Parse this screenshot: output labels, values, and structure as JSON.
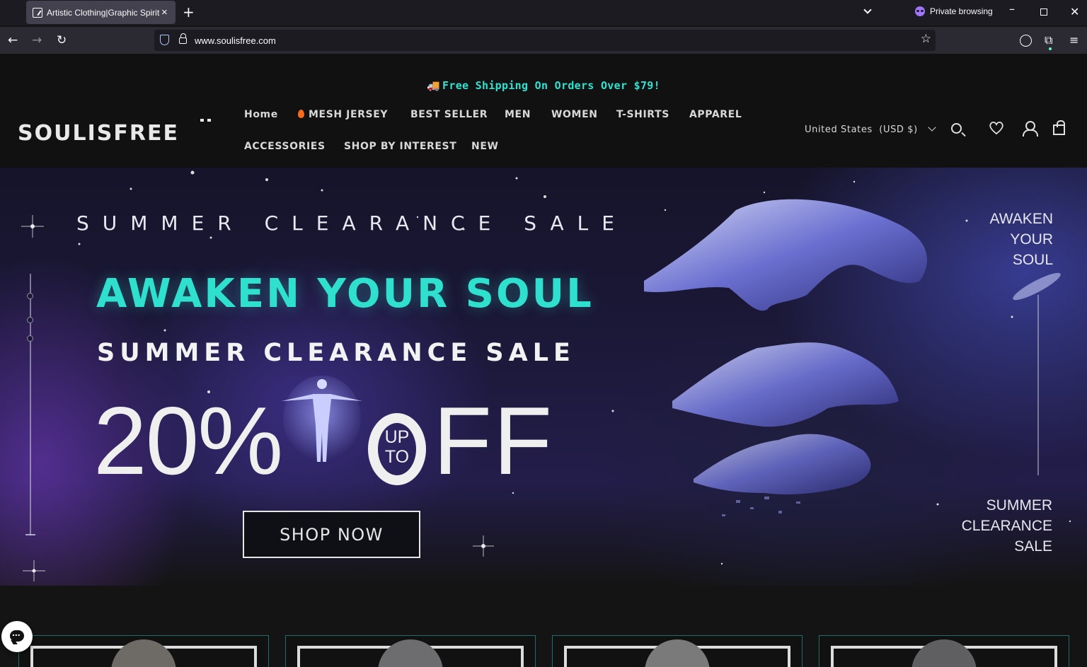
{
  "browser": {
    "tab_title": "Artistic Clothing|Graphic Spiritu",
    "tab_close": "×",
    "new_tab": "+",
    "private_label": "Private browsing",
    "url_host": "www.soulisfree.com",
    "win_min": "–",
    "win_close": "✕",
    "back": "←",
    "forward": "→",
    "reload": "↻",
    "star": "☆",
    "extensions": "⧉",
    "menu": "≡"
  },
  "site": {
    "announcement": "Free Shipping On Orders Over $79!",
    "announcement_icon": "🚚",
    "logo_alt": "SOULISFREE",
    "nav": {
      "home": "Home",
      "mesh_jersey": "MESH JERSEY",
      "best_seller": "BEST SELLER",
      "men": "MEN",
      "women": "WOMEN",
      "tshirts": "T-SHIRTS",
      "apparel": "APPAREL",
      "accessories": "ACCESSORIES",
      "shop_by_interest": "SHOP BY INTEREST",
      "new": "NEW"
    },
    "locale": "United States  (USD $)",
    "colors": {
      "accent": "#2fe0cf",
      "background": "#111111",
      "text": "#d8d8d8"
    }
  },
  "hero": {
    "top_line": "SUMMER CLEARANCE SALE",
    "headline": "AWAKEN YOUR SOUL",
    "subheadline": "SUMMER CLEARANCE SALE",
    "percent": "20%",
    "up": "UP",
    "to": "TO",
    "off": "FF",
    "cta": "SHOP NOW",
    "right_top": [
      "AWAKEN",
      "YOUR",
      "SOUL"
    ],
    "right_bottom": [
      "SUMMER",
      "CLEARANCE",
      "SALE"
    ]
  },
  "products": {
    "count": 4
  }
}
